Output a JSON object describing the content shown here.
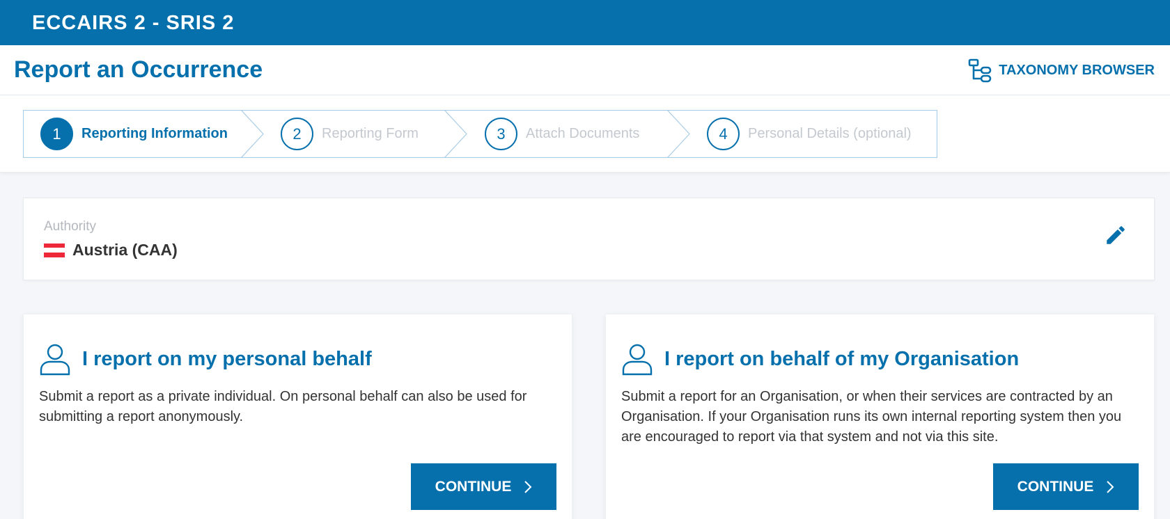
{
  "app": {
    "logo_text": "ECCAIRS 2 - SRIS 2"
  },
  "header": {
    "title": "Report an Occurrence",
    "taxonomy_browser_label": "TAXONOMY BROWSER"
  },
  "steps": [
    {
      "number": "1",
      "label": "Reporting Information",
      "active": true
    },
    {
      "number": "2",
      "label": "Reporting Form",
      "active": false
    },
    {
      "number": "3",
      "label": "Attach Documents",
      "active": false
    },
    {
      "number": "4",
      "label": "Personal Details (optional)",
      "active": false
    }
  ],
  "authority": {
    "label": "Authority",
    "value": "Austria (CAA)",
    "flag_colors": [
      "#ed2939",
      "#ffffff",
      "#ed2939"
    ]
  },
  "cards": {
    "personal": {
      "title": "I report on my personal behalf",
      "description": "Submit a report as a private individual. On personal behalf can also be used for submitting a report anonymously.",
      "button": "CONTINUE"
    },
    "organisation": {
      "title": "I report on behalf of my Organisation",
      "description": "Submit a report for an Organisation, or when their services are contracted by an Organisation. If your Organisation runs its own internal reporting system then you are encouraged to report via that system and not via this site.",
      "button": "CONTINUE"
    }
  },
  "icons": {
    "taxonomy": "tree-structure-icon",
    "edit": "pencil-icon",
    "user": "user-outline-icon",
    "chevron": "chevron-right-icon"
  },
  "colors": {
    "brand": "#0670ad",
    "inactive_step": "#c4c9cf",
    "border": "#a9cde6"
  }
}
